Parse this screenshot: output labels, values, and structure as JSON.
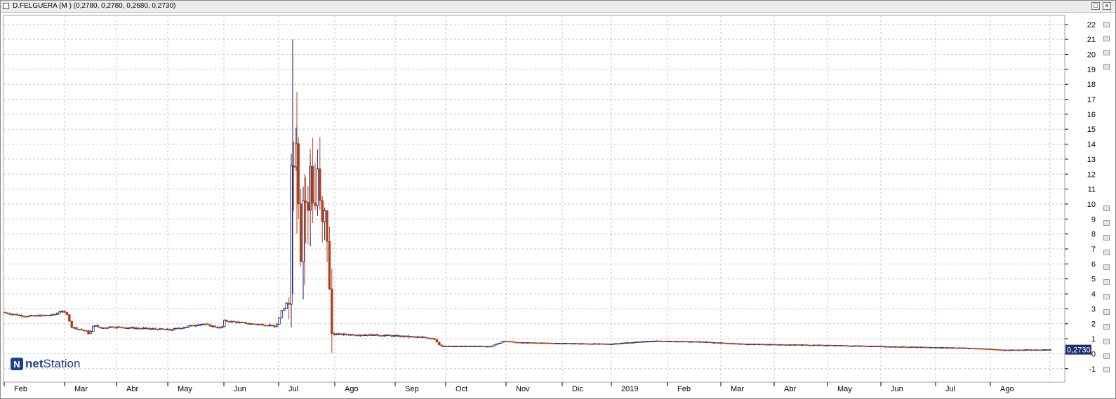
{
  "window": {
    "title": "D.FELGUERA (M ) (0,2780, 0,2780, 0,2680, 0,2730)",
    "maximize_glyph": "□",
    "close_glyph": "×"
  },
  "logo": {
    "mark": "N",
    "text_bold": "net",
    "text_regular": "Station"
  },
  "chart_data": {
    "type": "candlestick",
    "title": "D.FELGUERA (M )",
    "ohlc_last": {
      "open": "0,2780",
      "high": "0,2780",
      "low": "0,2680",
      "close": "0,2730"
    },
    "last_value_label": "0,2730",
    "ylim": [
      -1.9,
      22.6
    ],
    "yticks": [
      -1,
      0,
      1,
      2,
      3,
      4,
      5,
      6,
      7,
      8,
      9,
      10,
      11,
      12,
      13,
      14,
      15,
      16,
      17,
      18,
      19,
      20,
      21,
      22
    ],
    "grid": true,
    "month_labels": [
      "Feb",
      "Mar",
      "Abr",
      "May",
      "Jun",
      "Jul",
      "Ago",
      "Sep",
      "Oct",
      "Nov",
      "Dic",
      "2019",
      "Feb",
      "Mar",
      "Abr",
      "May",
      "Jun",
      "Jul",
      "Ago"
    ],
    "colors": {
      "up": "#1a1a66",
      "down": "#b0401a",
      "grid": "#c8c8c8",
      "label_bg": "#1f2f6f"
    },
    "price_path": [
      [
        0,
        2.8
      ],
      [
        40,
        2.5
      ],
      [
        80,
        2.6
      ],
      [
        90,
        2.9
      ],
      [
        100,
        2.5
      ],
      [
        103,
        1.8
      ],
      [
        125,
        1.5
      ],
      [
        130,
        1.3
      ],
      [
        137,
        2.0
      ],
      [
        143,
        1.7
      ],
      [
        160,
        1.8
      ],
      [
        200,
        1.7
      ],
      [
        245,
        1.6
      ],
      [
        290,
        2.0
      ],
      [
        318,
        1.7
      ],
      [
        322,
        2.2
      ],
      [
        360,
        2.0
      ],
      [
        390,
        1.9
      ],
      [
        395,
        1.7
      ],
      [
        404,
        2.9
      ],
      [
        408,
        3.0
      ],
      [
        415,
        4.0
      ],
      [
        416,
        14.0
      ],
      [
        422,
        12.0
      ],
      [
        425,
        16.0
      ],
      [
        428,
        10.0
      ],
      [
        430,
        6.0
      ],
      [
        436,
        12.0
      ],
      [
        440,
        8.0
      ],
      [
        445,
        13.0
      ],
      [
        450,
        9.0
      ],
      [
        455,
        12.5
      ],
      [
        460,
        8.0
      ],
      [
        465,
        9.0
      ],
      [
        470,
        7.5
      ],
      [
        473,
        1.4
      ],
      [
        478,
        1.3
      ],
      [
        540,
        1.25
      ],
      [
        580,
        1.15
      ],
      [
        620,
        1.05
      ],
      [
        630,
        0.5
      ],
      [
        700,
        0.5
      ],
      [
        705,
        0.55
      ],
      [
        720,
        0.85
      ],
      [
        740,
        0.75
      ],
      [
        800,
        0.7
      ],
      [
        870,
        0.65
      ],
      [
        930,
        0.85
      ],
      [
        1000,
        0.8
      ],
      [
        1060,
        0.65
      ],
      [
        1140,
        0.6
      ],
      [
        1200,
        0.55
      ],
      [
        1300,
        0.45
      ],
      [
        1360,
        0.4
      ],
      [
        1400,
        0.35
      ],
      [
        1430,
        0.25
      ],
      [
        1495,
        0.27
      ]
    ]
  }
}
